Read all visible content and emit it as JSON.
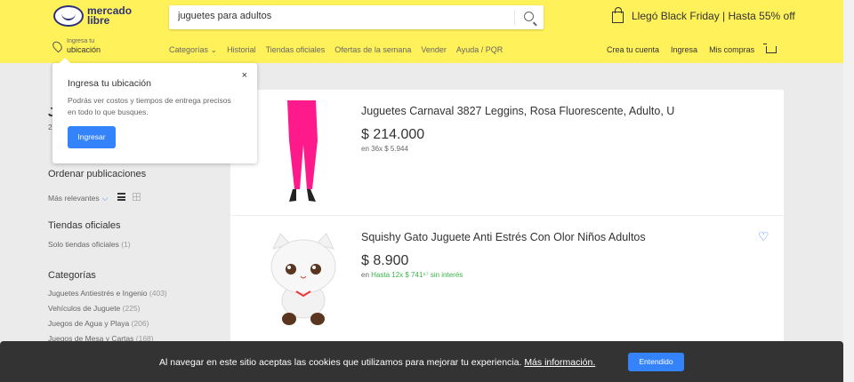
{
  "header": {
    "logo_line1": "mercado",
    "logo_line2": "libre",
    "search": {
      "value": "juguetes para adultos"
    },
    "promo": "Llegó Black Friday | Hasta 55% off",
    "location": {
      "line1": "Ingresa tu",
      "line2": "ubicación"
    },
    "nav": [
      "Categorías ⌄",
      "Historial",
      "Tiendas oficiales",
      "Ofertas de la semana",
      "Vender",
      "Ayuda / PQR"
    ],
    "account": [
      "Crea tu cuenta",
      "Ingresa",
      "Mis compras"
    ]
  },
  "popover": {
    "title": "Ingresa tu ubicación",
    "text": "Podrás ver costos y tiempos de entrega precisos en todo lo que busques.",
    "button": "Ingresar",
    "close": "×"
  },
  "sidebar": {
    "partial_title": "J",
    "partial_count": "2",
    "sort_title": "Ordenar publicaciones",
    "sort_value": "Más relevantes",
    "official_title": "Tiendas oficiales",
    "official_item": {
      "label": "Solo tiendas oficiales",
      "count": "(1)"
    },
    "categories_title": "Categorías",
    "categories": [
      {
        "label": "Juguetes Antiestrés e Ingenio",
        "count": "(403)"
      },
      {
        "label": "Vehículos de Juguete",
        "count": "(225)"
      },
      {
        "label": "Juegos de Agua y Playa",
        "count": "(206)"
      },
      {
        "label": "Juegos de Mesa y Cartas",
        "count": "(168)"
      }
    ]
  },
  "results": [
    {
      "title": "Juguetes Carnaval 3827 Leggins, Rosa Fluorescente, Adulto, U",
      "price": "$ 214.000",
      "installments": "en 36x $ 5.944"
    },
    {
      "title": "Squishy Gato Juguete Anti Estrés Con Olor Niños Adultos",
      "price": "$ 8.900",
      "installments_prefix": "en",
      "installments_green": "Hasta 12x $ 741⁶⁷ sin interés"
    }
  ],
  "cookie": {
    "text": "Al navegar en este sitio aceptas las cookies que utilizamos para mejorar tu experiencia.",
    "link": "Más información.",
    "button": "Entendido"
  },
  "colors": {
    "header": "#fff159",
    "accent": "#3483fa",
    "green": "#39b54a"
  }
}
